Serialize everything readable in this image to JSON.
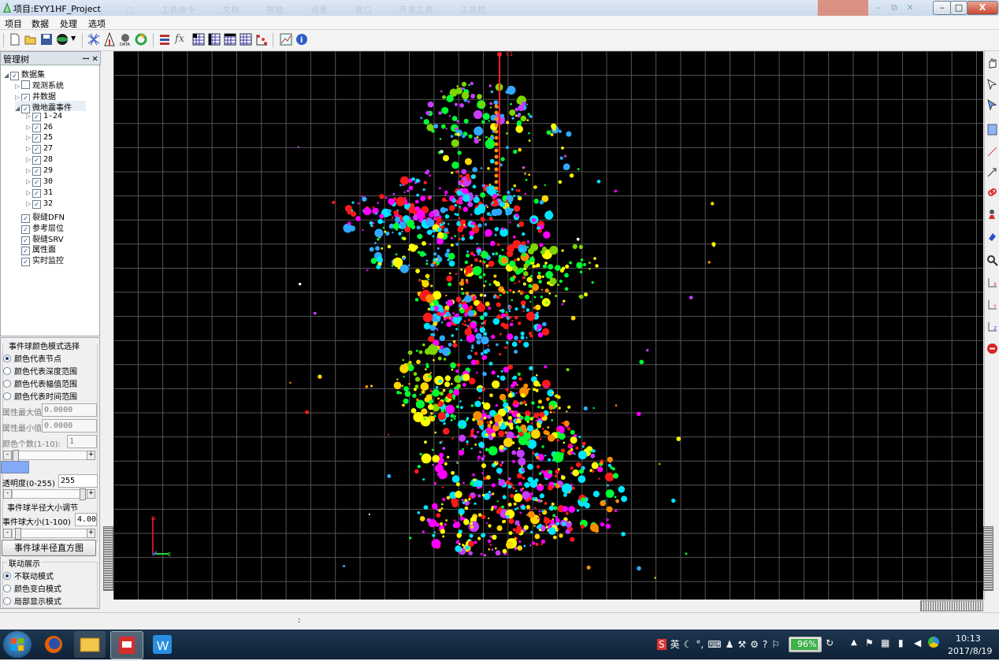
{
  "window": {
    "title": "项目:EYY1HF_Project",
    "faint_tabs": [
      "□",
      "工具命令",
      "文档",
      "帮助",
      "设置",
      "窗口",
      "开发工具",
      "工具栏"
    ],
    "controls": {
      "minimize": "–",
      "maximize": "□",
      "close": "X"
    }
  },
  "menu": [
    "项目",
    "数据",
    "处理",
    "选项"
  ],
  "toolbar": {
    "icons": [
      "new-file-icon",
      "open-folder-icon",
      "save-icon",
      "globe-icon",
      "grid-net-icon",
      "well-tower-icon",
      "data-disk-icon",
      "refresh-color-icon",
      "stack-layers-icon",
      "function-fx-icon",
      "grid-blue-1-icon",
      "grid-blue-2-icon",
      "grid-blue-3-icon",
      "grid-blue-4-icon",
      "scatter-icon",
      "map-view-icon",
      "info-icon"
    ],
    "fx_label": "fx"
  },
  "tree": {
    "header": "管理树",
    "header_buttons": "ꟷ ✕",
    "items": [
      {
        "label": "数据集",
        "level": 0,
        "checked": true,
        "expanded": true
      },
      {
        "label": "观测系统",
        "level": 1,
        "checked": false
      },
      {
        "label": "井数据",
        "level": 1,
        "checked": true
      },
      {
        "label": "微地震事件",
        "level": 1,
        "checked": true,
        "expanded": true
      },
      {
        "label": "1-24",
        "level": 2,
        "checked": true
      },
      {
        "label": "26",
        "level": 2,
        "checked": true
      },
      {
        "label": "25",
        "level": 2,
        "checked": true
      },
      {
        "label": "27",
        "level": 2,
        "checked": true
      },
      {
        "label": "28",
        "level": 2,
        "checked": true
      },
      {
        "label": "29",
        "level": 2,
        "checked": true
      },
      {
        "label": "30",
        "level": 2,
        "checked": true
      },
      {
        "label": "31",
        "level": 2,
        "checked": true
      },
      {
        "label": "32",
        "level": 2,
        "checked": true
      },
      {
        "label": "裂缝DFN",
        "level": 1,
        "checked": true
      },
      {
        "label": "参考层位",
        "level": 1,
        "checked": true
      },
      {
        "label": "裂缝SRV",
        "level": 1,
        "checked": true
      },
      {
        "label": "属性面",
        "level": 1,
        "checked": true
      },
      {
        "label": "实时监控",
        "level": 1,
        "checked": true
      }
    ]
  },
  "controls": {
    "color_mode_title": "事件球颜色模式选择",
    "color_modes": [
      "颜色代表节点",
      "颜色代表深度范围",
      "颜色代表幅值范围",
      "颜色代表时间范围"
    ],
    "attr_max_label": "属性最大值",
    "attr_max_value": "0.0000",
    "attr_min_label": "属性最小值",
    "attr_min_value": "0.0000",
    "color_count_label": "颜色个数(1-10):",
    "color_count_value": "1",
    "swatch_color": "#83aaf6",
    "transparency_label": "透明度(0-255)",
    "transparency_value": "255",
    "radius_title": "事件球半径大小调节",
    "size_label": "事件球大小(1-100)",
    "size_value": "4.00",
    "histogram_button": "事件球半径直方图",
    "linkage_title": "联动展示",
    "linkage_modes": [
      "不联动模式",
      "颜色变白模式",
      "局部显示模式"
    ],
    "minus": "-",
    "plus": "+"
  },
  "plot": {
    "well_label": "c1",
    "north_label": "N",
    "east_label": "E",
    "palette": [
      "#ff1a1a",
      "#ff00ff",
      "#c73cff",
      "#00e5ff",
      "#2fa9ff",
      "#ffff00",
      "#ffd700",
      "#00ff33",
      "#7cd600",
      "#ff8c00",
      "#ffffff"
    ]
  },
  "status": {
    "text": ":"
  },
  "taskbar": {
    "ime_items": [
      "S",
      "英",
      "☾",
      "°,",
      "⌨",
      "♟",
      "⚒",
      "⚙",
      "?",
      "⚐"
    ],
    "battery": "96%",
    "time": "10:13",
    "date": "2017/8/19"
  }
}
